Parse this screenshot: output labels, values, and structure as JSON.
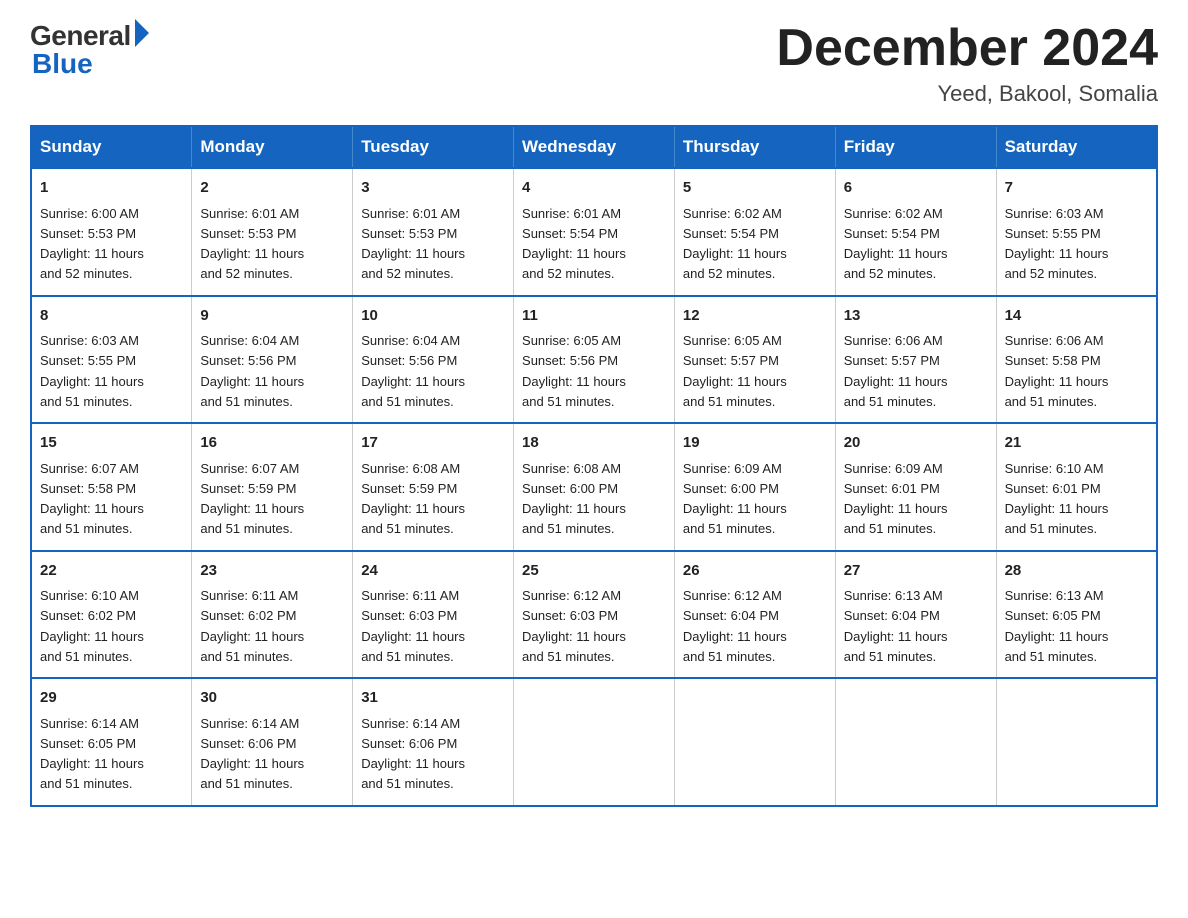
{
  "header": {
    "logo_general": "General",
    "logo_blue": "Blue",
    "month_title": "December 2024",
    "location": "Yeed, Bakool, Somalia"
  },
  "calendar": {
    "days_of_week": [
      "Sunday",
      "Monday",
      "Tuesday",
      "Wednesday",
      "Thursday",
      "Friday",
      "Saturday"
    ],
    "weeks": [
      [
        {
          "day": "1",
          "info": "Sunrise: 6:00 AM\nSunset: 5:53 PM\nDaylight: 11 hours\nand 52 minutes."
        },
        {
          "day": "2",
          "info": "Sunrise: 6:01 AM\nSunset: 5:53 PM\nDaylight: 11 hours\nand 52 minutes."
        },
        {
          "day": "3",
          "info": "Sunrise: 6:01 AM\nSunset: 5:53 PM\nDaylight: 11 hours\nand 52 minutes."
        },
        {
          "day": "4",
          "info": "Sunrise: 6:01 AM\nSunset: 5:54 PM\nDaylight: 11 hours\nand 52 minutes."
        },
        {
          "day": "5",
          "info": "Sunrise: 6:02 AM\nSunset: 5:54 PM\nDaylight: 11 hours\nand 52 minutes."
        },
        {
          "day": "6",
          "info": "Sunrise: 6:02 AM\nSunset: 5:54 PM\nDaylight: 11 hours\nand 52 minutes."
        },
        {
          "day": "7",
          "info": "Sunrise: 6:03 AM\nSunset: 5:55 PM\nDaylight: 11 hours\nand 52 minutes."
        }
      ],
      [
        {
          "day": "8",
          "info": "Sunrise: 6:03 AM\nSunset: 5:55 PM\nDaylight: 11 hours\nand 51 minutes."
        },
        {
          "day": "9",
          "info": "Sunrise: 6:04 AM\nSunset: 5:56 PM\nDaylight: 11 hours\nand 51 minutes."
        },
        {
          "day": "10",
          "info": "Sunrise: 6:04 AM\nSunset: 5:56 PM\nDaylight: 11 hours\nand 51 minutes."
        },
        {
          "day": "11",
          "info": "Sunrise: 6:05 AM\nSunset: 5:56 PM\nDaylight: 11 hours\nand 51 minutes."
        },
        {
          "day": "12",
          "info": "Sunrise: 6:05 AM\nSunset: 5:57 PM\nDaylight: 11 hours\nand 51 minutes."
        },
        {
          "day": "13",
          "info": "Sunrise: 6:06 AM\nSunset: 5:57 PM\nDaylight: 11 hours\nand 51 minutes."
        },
        {
          "day": "14",
          "info": "Sunrise: 6:06 AM\nSunset: 5:58 PM\nDaylight: 11 hours\nand 51 minutes."
        }
      ],
      [
        {
          "day": "15",
          "info": "Sunrise: 6:07 AM\nSunset: 5:58 PM\nDaylight: 11 hours\nand 51 minutes."
        },
        {
          "day": "16",
          "info": "Sunrise: 6:07 AM\nSunset: 5:59 PM\nDaylight: 11 hours\nand 51 minutes."
        },
        {
          "day": "17",
          "info": "Sunrise: 6:08 AM\nSunset: 5:59 PM\nDaylight: 11 hours\nand 51 minutes."
        },
        {
          "day": "18",
          "info": "Sunrise: 6:08 AM\nSunset: 6:00 PM\nDaylight: 11 hours\nand 51 minutes."
        },
        {
          "day": "19",
          "info": "Sunrise: 6:09 AM\nSunset: 6:00 PM\nDaylight: 11 hours\nand 51 minutes."
        },
        {
          "day": "20",
          "info": "Sunrise: 6:09 AM\nSunset: 6:01 PM\nDaylight: 11 hours\nand 51 minutes."
        },
        {
          "day": "21",
          "info": "Sunrise: 6:10 AM\nSunset: 6:01 PM\nDaylight: 11 hours\nand 51 minutes."
        }
      ],
      [
        {
          "day": "22",
          "info": "Sunrise: 6:10 AM\nSunset: 6:02 PM\nDaylight: 11 hours\nand 51 minutes."
        },
        {
          "day": "23",
          "info": "Sunrise: 6:11 AM\nSunset: 6:02 PM\nDaylight: 11 hours\nand 51 minutes."
        },
        {
          "day": "24",
          "info": "Sunrise: 6:11 AM\nSunset: 6:03 PM\nDaylight: 11 hours\nand 51 minutes."
        },
        {
          "day": "25",
          "info": "Sunrise: 6:12 AM\nSunset: 6:03 PM\nDaylight: 11 hours\nand 51 minutes."
        },
        {
          "day": "26",
          "info": "Sunrise: 6:12 AM\nSunset: 6:04 PM\nDaylight: 11 hours\nand 51 minutes."
        },
        {
          "day": "27",
          "info": "Sunrise: 6:13 AM\nSunset: 6:04 PM\nDaylight: 11 hours\nand 51 minutes."
        },
        {
          "day": "28",
          "info": "Sunrise: 6:13 AM\nSunset: 6:05 PM\nDaylight: 11 hours\nand 51 minutes."
        }
      ],
      [
        {
          "day": "29",
          "info": "Sunrise: 6:14 AM\nSunset: 6:05 PM\nDaylight: 11 hours\nand 51 minutes."
        },
        {
          "day": "30",
          "info": "Sunrise: 6:14 AM\nSunset: 6:06 PM\nDaylight: 11 hours\nand 51 minutes."
        },
        {
          "day": "31",
          "info": "Sunrise: 6:14 AM\nSunset: 6:06 PM\nDaylight: 11 hours\nand 51 minutes."
        },
        {
          "day": "",
          "info": ""
        },
        {
          "day": "",
          "info": ""
        },
        {
          "day": "",
          "info": ""
        },
        {
          "day": "",
          "info": ""
        }
      ]
    ]
  }
}
